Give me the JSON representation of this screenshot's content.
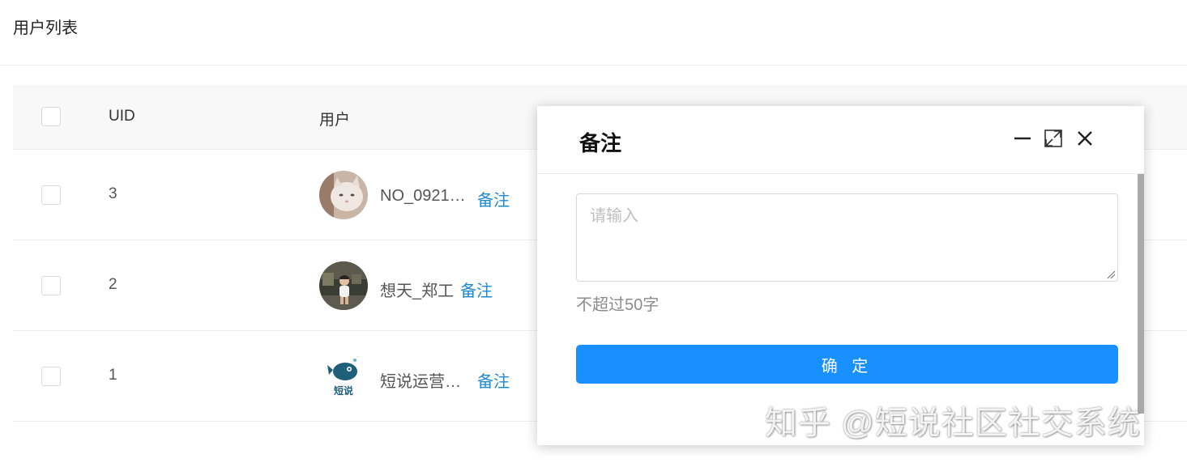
{
  "page": {
    "title": "用户列表"
  },
  "table": {
    "headers": {
      "uid": "UID",
      "user": "用户"
    },
    "rows": [
      {
        "uid": "3",
        "name": "NO_0921…",
        "remark": "备注",
        "avatar": "cat-photo-avatar"
      },
      {
        "uid": "2",
        "name": "想天_郑工",
        "remark": "备注",
        "avatar": "child-photo-avatar"
      },
      {
        "uid": "1",
        "name": "短说运营…",
        "remark": "备注",
        "avatar": "duanshuo-logo-avatar"
      }
    ]
  },
  "dialog": {
    "title": "备注",
    "placeholder": "请输入",
    "value": "",
    "hint": "不超过50字",
    "confirm_label": "确 定",
    "icons": [
      "minimize-icon",
      "maximize-icon",
      "close-icon"
    ]
  },
  "avatar_logo_text": "短说",
  "watermark": "知乎 @短说社区社交系统",
  "colors": {
    "link": "#1f8ad4",
    "primary": "#1890ff",
    "header_bg": "#f8f8f8",
    "border": "#ececec"
  }
}
